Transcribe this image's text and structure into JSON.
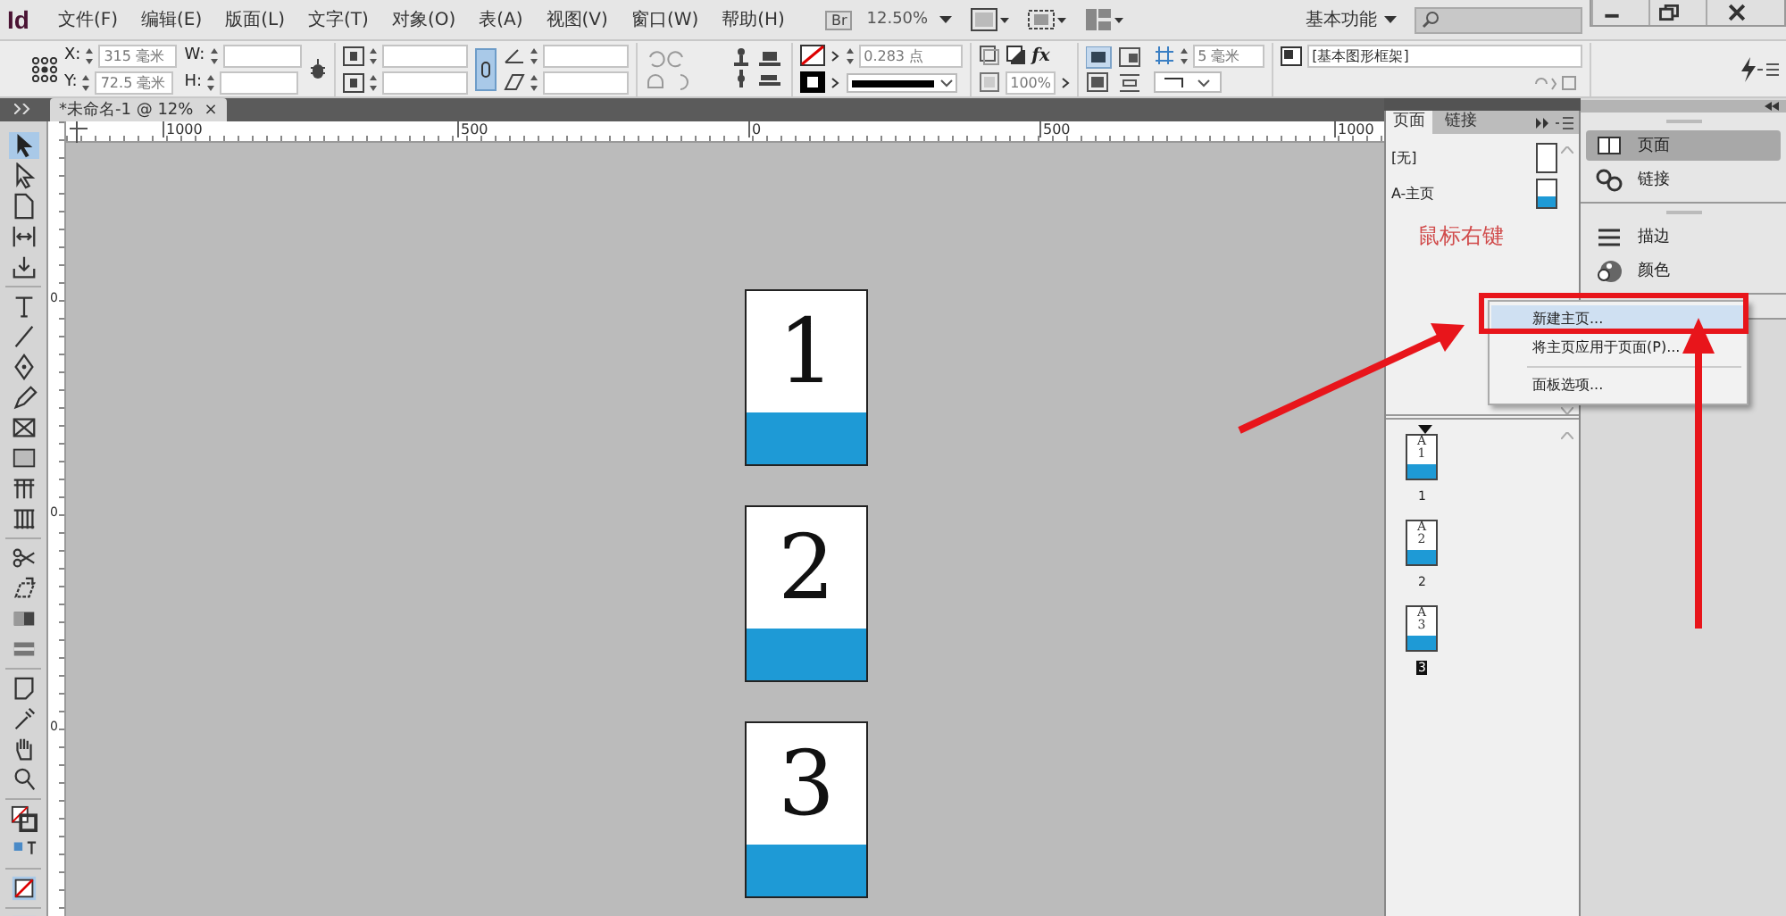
{
  "app": {
    "logo": "Id",
    "menu": [
      "文件(F)",
      "编辑(E)",
      "版面(L)",
      "文字(T)",
      "对象(O)",
      "表(A)",
      "视图(V)",
      "窗口(W)",
      "帮助(H)"
    ],
    "bridge": "Br",
    "zoom": "12.50%",
    "workspace": "基本功能"
  },
  "control_bar": {
    "x_label": "X:",
    "x_value": "315 毫米",
    "y_label": "Y:",
    "y_value": "72.5 毫米",
    "w_label": "W:",
    "h_label": "H:",
    "stroke_weight": "0.283 点",
    "effects": "fx",
    "opacity": "100%",
    "corner_size": "5 毫米",
    "object_style": "[基本图形框架]"
  },
  "document_tab": {
    "title": "*未命名-1 @ 12%",
    "close": "×"
  },
  "ruler": {
    "labels": [
      "1000",
      "500",
      "0",
      "500",
      "1000"
    ],
    "vertical_labels": [
      "0",
      "0",
      "0"
    ]
  },
  "canvas": {
    "pages": [
      {
        "number": "1"
      },
      {
        "number": "2"
      },
      {
        "number": "3"
      }
    ]
  },
  "pages_panel": {
    "tabs": [
      {
        "label": "页面",
        "selected": true
      },
      {
        "label": "链接",
        "selected": false
      }
    ],
    "masters": [
      {
        "name": "[无]",
        "kind": "none"
      },
      {
        "name": "A-主页",
        "kind": "master"
      }
    ],
    "pages": [
      {
        "prefix": "A",
        "number": "1",
        "label": "1",
        "selected": false
      },
      {
        "prefix": "A",
        "number": "2",
        "label": "2",
        "selected": false
      },
      {
        "prefix": "A",
        "number": "3",
        "label": "3",
        "selected": true
      }
    ]
  },
  "annotation": "鼠标右键",
  "context_menu": {
    "groups": [
      {
        "items": [
          {
            "label": "新建主页...",
            "selected": true
          },
          {
            "label": "将主页应用于页面(P)...",
            "selected": false
          }
        ]
      },
      {
        "items": [
          {
            "label": "面板选项...",
            "selected": false
          }
        ]
      }
    ]
  },
  "dock": {
    "groups": [
      {
        "items": [
          {
            "label": "页面",
            "kind": "pages",
            "selected": true
          },
          {
            "label": "链接",
            "kind": "links",
            "selected": false
          }
        ]
      },
      {
        "items": [
          {
            "label": "描边",
            "kind": "stroke",
            "selected": false
          },
          {
            "label": "颜色",
            "kind": "color",
            "selected": false
          }
        ]
      }
    ]
  }
}
